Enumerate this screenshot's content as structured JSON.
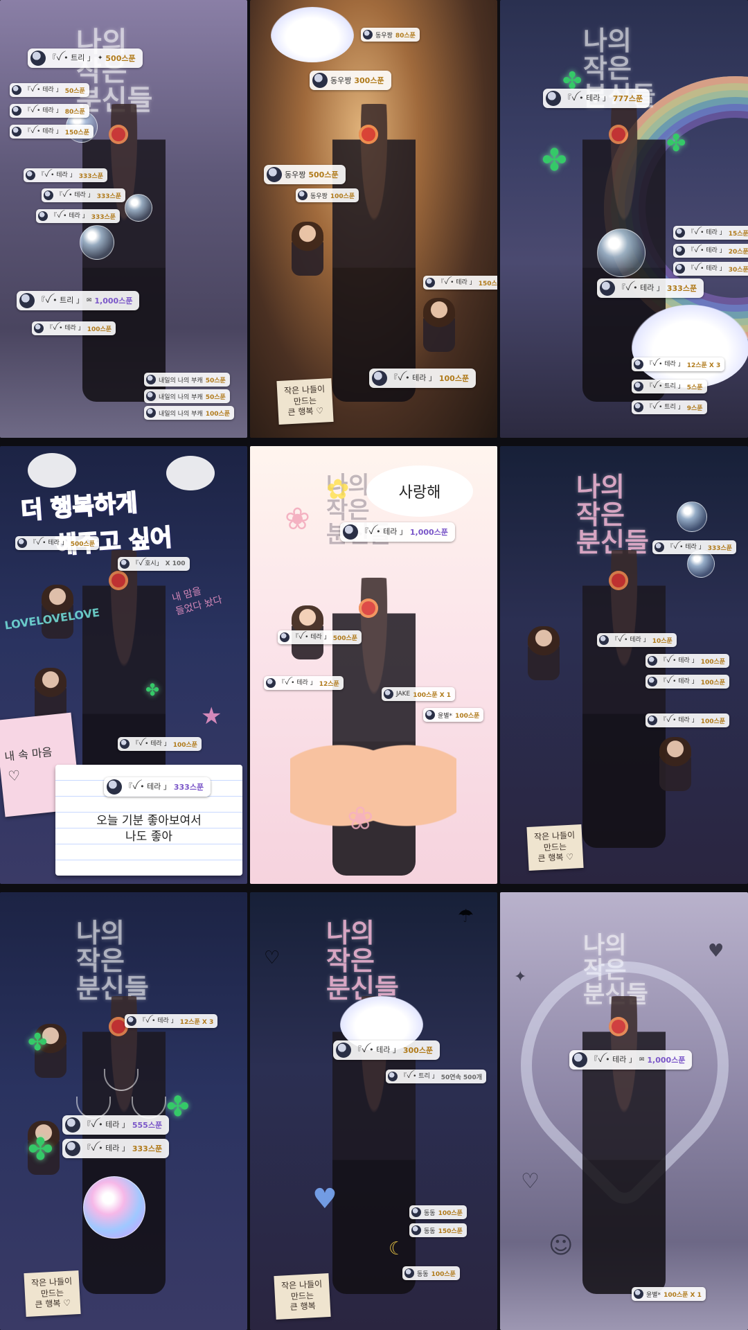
{
  "panels": {
    "p1": {
      "title_ghost": "나의\n작은\n분신들",
      "chips": [
        {
          "name": "『ꪜ • 트리 」",
          "amount": "500스푼",
          "big": true
        },
        {
          "name": "『ꪜ • 테라 」",
          "amount": "50스푼"
        },
        {
          "name": "『ꪜ • 테라 」",
          "amount": "80스푼"
        },
        {
          "name": "『ꪜ • 테라 」",
          "amount": "150스푼"
        },
        {
          "name": "『ꪜ • 테라 」",
          "amount": "333스푼"
        },
        {
          "name": "『ꪜ • 테라 」",
          "amount": "333스푼"
        },
        {
          "name": "『ꪜ • 테라 」",
          "amount": "333스푼"
        },
        {
          "name": "『ꪜ • 트리 」",
          "amount": "1,000스푼",
          "big": true
        },
        {
          "name": "『ꪜ • 테라 」",
          "amount": "100스푼"
        },
        {
          "name": "내일의 나의 부캐",
          "amount": "50스푼"
        },
        {
          "name": "내일의 나의 부캐",
          "amount": "50스푼"
        },
        {
          "name": "내일의 나의 부캐",
          "amount": "100스푼"
        }
      ]
    },
    "p2": {
      "note": "작은 나들이\n만드는\n큰 행복 ♡",
      "chips": [
        {
          "name": "동우짱",
          "amount": "80스푼"
        },
        {
          "name": "동우짱",
          "amount": "300스푼"
        },
        {
          "name": "동우짱",
          "amount": "500스푼",
          "big": true
        },
        {
          "name": "동우짱",
          "amount": "100스푼"
        },
        {
          "name": "『ꪜ • 테라 」",
          "amount": "150스푼"
        },
        {
          "name": "『ꪜ • 테라 」",
          "amount": "100스푼"
        }
      ]
    },
    "p3": {
      "title_ghost": "나의\n작은\n분신들",
      "chips": [
        {
          "name": "『ꪜ • 테라 」",
          "amount": "777스푼",
          "big": true
        },
        {
          "name": "『ꪜ • 테라 」",
          "amount": "15스푼"
        },
        {
          "name": "『ꪜ • 테라 」",
          "amount": "20스푼"
        },
        {
          "name": "『ꪜ • 테라 」",
          "amount": "30스푼"
        },
        {
          "name": "『ꪜ • 테라 」",
          "amount": "333스푼"
        },
        {
          "name": "『ꪜ • 테라 」",
          "amount": "12스푼 X 3"
        },
        {
          "name": "『ꪜ • 트리 」",
          "amount": "5스푼"
        },
        {
          "name": "『ꪜ • 트리 」",
          "amount": "9스푼"
        }
      ]
    },
    "p4": {
      "headline_1": "더 행복하게",
      "headline_2": "해주고 싶어",
      "love": "LOVELOVELOVE",
      "side_note": "내 맘을\n들었다 놨다",
      "pink_note": "내 속 마음",
      "bottom_note": "오늘 기분 좋아보여서\n나도 좋아",
      "chips": [
        {
          "name": "『ꪜ • 테라 」",
          "amount": "500스푼"
        },
        {
          "name": "『ꪜ 호시」",
          "amount": "X 100"
        },
        {
          "name": "『ꪜ • 테라 」",
          "amount": "100스푼"
        },
        {
          "name": "『ꪜ • 테라 」",
          "amount": "333스푼",
          "big": true
        }
      ]
    },
    "p5": {
      "speech": "사랑해",
      "title_ghost": "나의\n작은\n분신들",
      "chips": [
        {
          "name": "『ꪜ • 테라 」",
          "amount": "1,000스푼",
          "big": true
        },
        {
          "name": "『ꪜ • 테라 」",
          "amount": "500스푼"
        },
        {
          "name": "『ꪜ • 테라 」",
          "amount": "12스푼"
        },
        {
          "name": "JAKE",
          "amount": "100스푼 X 1"
        },
        {
          "name": "윤별*",
          "amount": "100스푼"
        }
      ]
    },
    "p6": {
      "title_ghost": "나의\n작은\n분신들",
      "note": "작은 나들이\n만드는\n큰 행복 ♡",
      "chips": [
        {
          "name": "『ꪜ • 테라 」",
          "amount": "333스푼"
        },
        {
          "name": "『ꪜ • 테라 」",
          "amount": "10스푼"
        },
        {
          "name": "『ꪜ • 테라 」",
          "amount": "100스푼"
        },
        {
          "name": "『ꪜ • 테라 」",
          "amount": "100스푼"
        },
        {
          "name": "『ꪜ • 테라 」",
          "amount": "100스푼"
        }
      ]
    },
    "p7": {
      "title_ghost": "나의\n작은\n분신들",
      "note": "작은 나들이\n만드는\n큰 행복 ♡",
      "chips": [
        {
          "name": "『ꪜ • 테라 」",
          "amount": "12스푼 X 3"
        },
        {
          "name": "『ꪜ • 테라 」",
          "amount": "555스푼"
        },
        {
          "name": "『ꪜ • 테라 」",
          "amount": "333스푼"
        }
      ]
    },
    "p8": {
      "title_ghost": "나의\n작은\n분신들",
      "note": "작은 나들이\n만드는\n큰 행복",
      "chips": [
        {
          "name": "『ꪜ • 테라 」",
          "amount": "300스푼",
          "big": true
        },
        {
          "name": "『ꪜ • 트리 」",
          "amount": "50연속 500개"
        },
        {
          "name": "동동",
          "amount": "100스푼"
        },
        {
          "name": "동동",
          "amount": "150스푼"
        },
        {
          "name": "동동",
          "amount": "100스푼"
        }
      ]
    },
    "p9": {
      "title_ghost": "나의\n작은\n분신들",
      "chips": [
        {
          "name": "『ꪜ • 테라 」",
          "amount": "1,000스푼",
          "big": true
        },
        {
          "name": "윤별*",
          "amount": "100스푼 X 1"
        }
      ]
    }
  }
}
